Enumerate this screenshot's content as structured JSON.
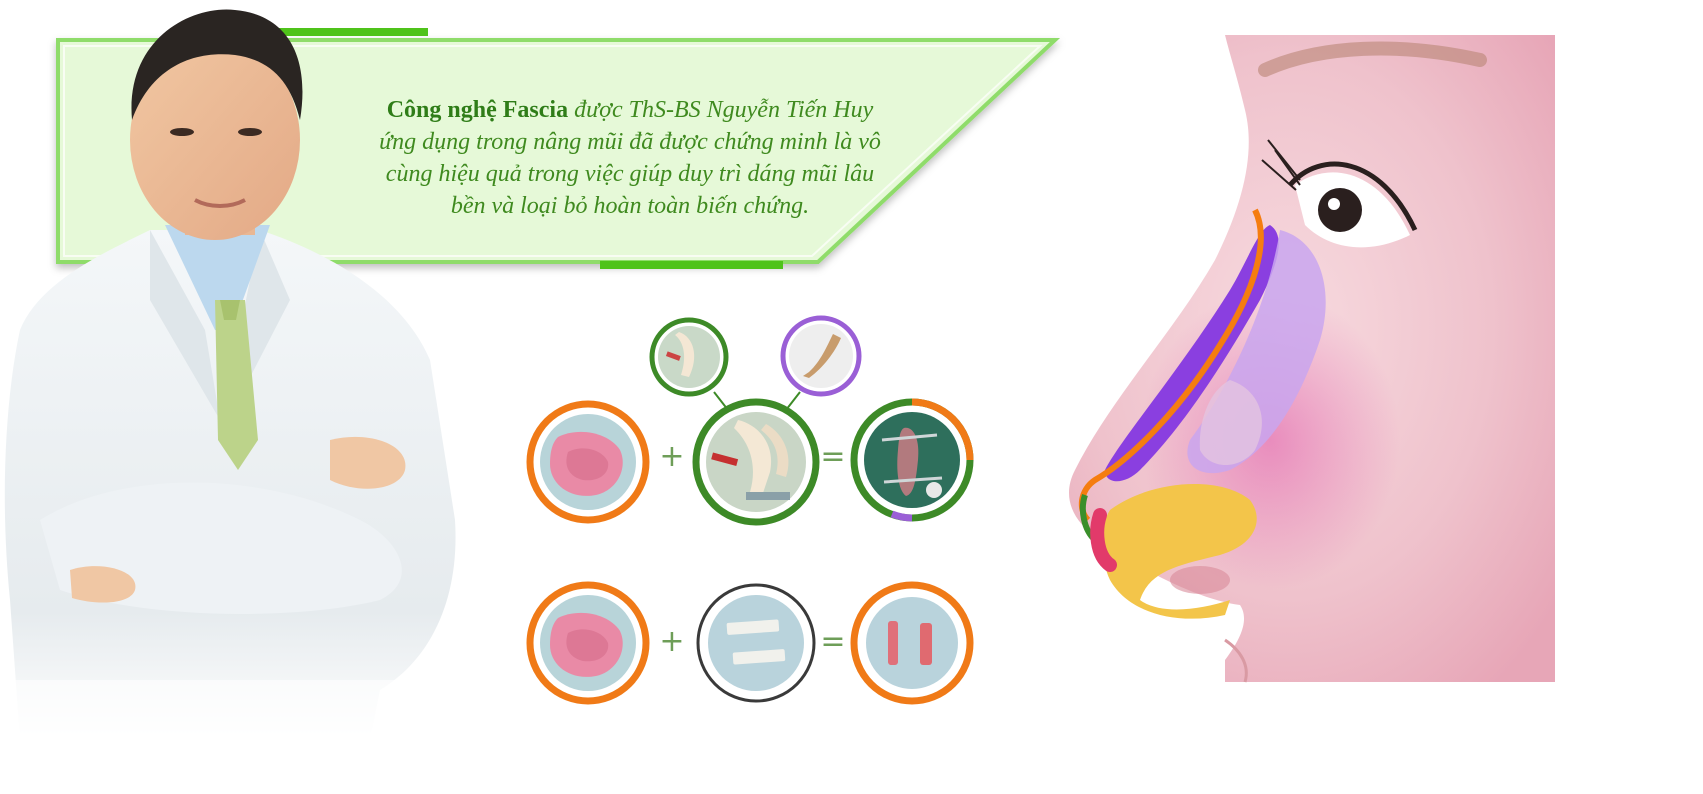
{
  "quote": {
    "highlight": "Công nghệ Fascia",
    "line1_rest": " được ThS-BS Nguyễn Tiến Huy",
    "line2": "ứng dụng trong nâng mũi đã được chứng minh là vô",
    "line3": "cùng hiệu quả trong việc giúp duy trì dáng mũi lâu",
    "line4": "bền và loại bỏ hoàn toàn biến chứng."
  },
  "equations": {
    "row1": {
      "plus": "+",
      "equals": "="
    },
    "row2": {
      "plus": "+",
      "equals": "="
    }
  },
  "colors": {
    "banner_fill": "#e6f9d8",
    "banner_border": "#8fdc6a",
    "accent_green": "#4fc31a",
    "text_green": "#3f8a1f",
    "ring_orange": "#f07a17",
    "ring_green": "#3d8a27",
    "ring_purple": "#9a5fd6",
    "nose_purple": "#8a3fe0",
    "nose_orange": "#f57d10"
  },
  "icons": {
    "doctor": "doctor-portrait-icon",
    "nose": "nose-profile-icon"
  }
}
